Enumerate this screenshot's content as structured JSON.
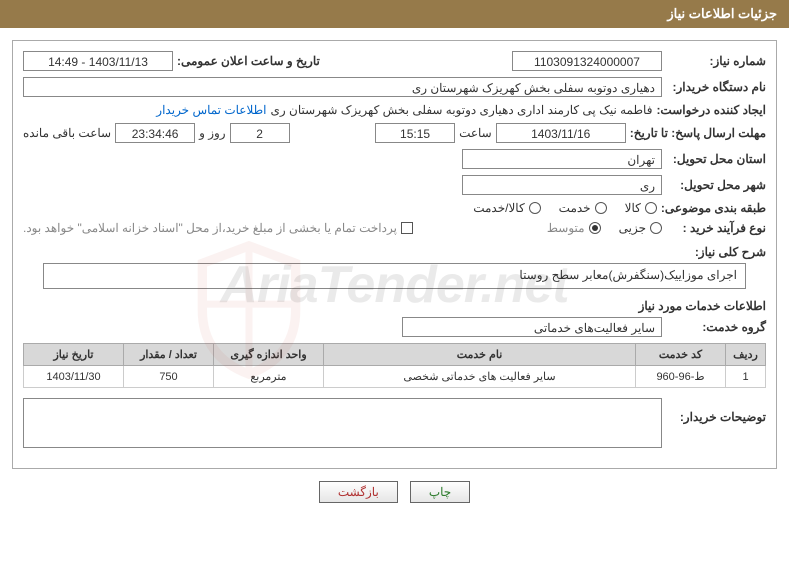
{
  "header": {
    "title": "جزئیات اطلاعات نیاز"
  },
  "fields": {
    "need_no_label": "شماره نیاز:",
    "need_no": "1103091324000007",
    "announce_label": "تاریخ و ساعت اعلان عمومی:",
    "announce_val": "1403/11/13 - 14:49",
    "buyer_label": "نام دستگاه خریدار:",
    "buyer_val": "دهیاری دوتوبه سفلی بخش کهریزک شهرستان ری",
    "creator_label": "ایجاد کننده درخواست:",
    "creator_val": "فاطمه نیک پی کارمند اداری دهیاری دوتوبه سفلی بخش کهریزک شهرستان ری",
    "contact_link": "اطلاعات تماس خریدار",
    "deadline_label": "مهلت ارسال پاسخ: تا تاریخ:",
    "deadline_date": "1403/11/16",
    "time_label": "ساعت",
    "deadline_time": "15:15",
    "day_val": "2",
    "day_and": "روز و",
    "remain_time": "23:34:46",
    "remain_label": "ساعت باقی مانده",
    "province_label": "استان محل تحویل:",
    "province_val": "تهران",
    "city_label": "شهر محل تحویل:",
    "city_val": "ری",
    "cat_label": "طبقه بندی موضوعی:",
    "cat_opts": {
      "goods": "کالا",
      "service": "خدمت",
      "goods_service": "کالا/خدمت"
    },
    "proc_label": "نوع فرآیند خرید :",
    "proc_opts": {
      "minor": "جزیی",
      "medium": "متوسط"
    },
    "pay_note": "پرداخت تمام یا بخشی از مبلغ خرید،از محل \"اسناد خزانه اسلامی\" خواهد بود."
  },
  "desc": {
    "label": "شرح کلی نیاز:",
    "text": "اجرای موزاییک(سنگفرش)معابر سطح روستا"
  },
  "services_section": "اطلاعات خدمات مورد نیاز",
  "group": {
    "label": "گروه خدمت:",
    "val": "سایر فعالیت‌های خدماتی"
  },
  "table": {
    "headers": [
      "ردیف",
      "کد خدمت",
      "نام خدمت",
      "واحد اندازه گیری",
      "تعداد / مقدار",
      "تاریخ نیاز"
    ],
    "rows": [
      {
        "idx": "1",
        "code": "ط-96-960",
        "name": "سایر فعالیت های خدماتی شخصی",
        "unit": "مترمربع",
        "qty": "750",
        "date": "1403/11/30"
      }
    ]
  },
  "buyer_notes_label": "توضیحات خریدار:",
  "buttons": {
    "print": "چاپ",
    "back": "بازگشت"
  },
  "watermark": "AriaTender.net"
}
